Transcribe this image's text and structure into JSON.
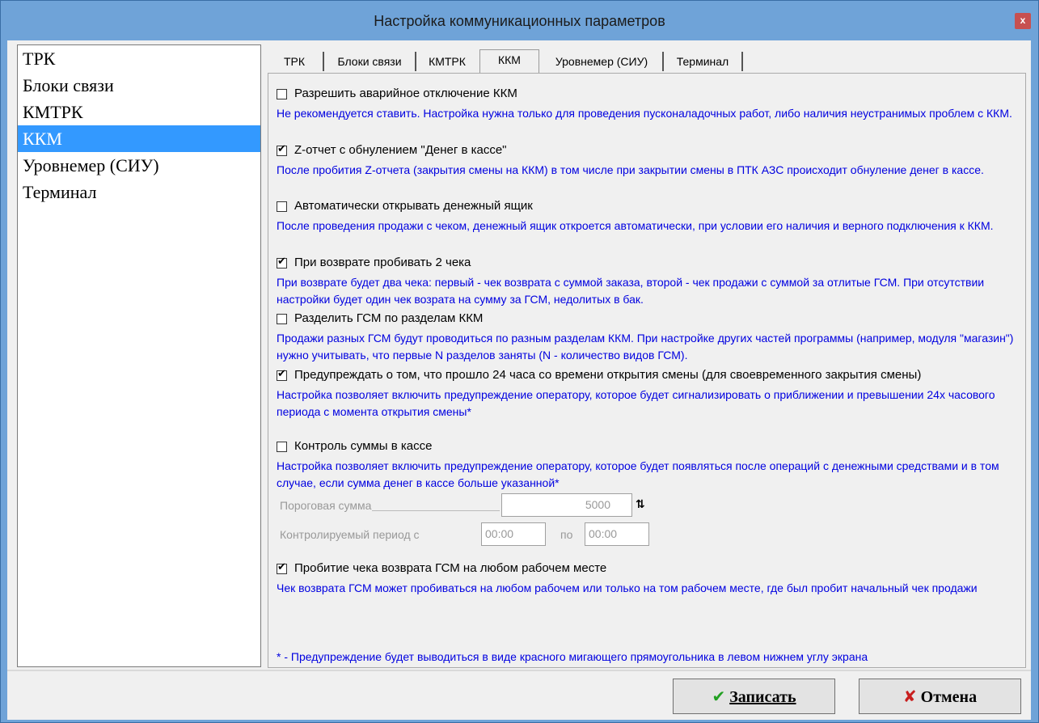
{
  "window": {
    "title": "Настройка коммуникационных параметров",
    "close_label": "x"
  },
  "sidebar": {
    "items": [
      {
        "label": "ТРК"
      },
      {
        "label": "Блоки связи"
      },
      {
        "label": "КМТРК"
      },
      {
        "label": "ККМ",
        "selected": true
      },
      {
        "label": "Уровнемер (СИУ)"
      },
      {
        "label": "Терминал"
      }
    ]
  },
  "tabs": [
    {
      "label": "ТРК"
    },
    {
      "label": "Блоки связи"
    },
    {
      "label": "КМТРК"
    },
    {
      "label": "ККМ",
      "selected": true
    },
    {
      "label": "Уровнемер (СИУ)"
    },
    {
      "label": "Терминал"
    }
  ],
  "options": [
    {
      "checked": false,
      "label": "Разрешить аварийное отключение ККМ",
      "desc": "Не рекомендуется ставить. Настройка нужна только для проведения пусконаладочных работ, либо наличия неустранимых проблем с ККМ."
    },
    {
      "checked": true,
      "label": "Z-отчет с обнулением \"Денег в кассе\"",
      "desc": "После пробития Z-отчета (закрытия смены на ККМ) в том числе при закрытии смены в ПТК АЗС происходит обнуление денег в кассе."
    },
    {
      "checked": false,
      "label": "Автоматически открывать денежный ящик",
      "desc": "После проведения продажи с чеком, денежный ящик откроется автоматически, при условии его наличия и верного подключения к ККМ."
    },
    {
      "checked": true,
      "label": "При возврате пробивать 2 чека",
      "desc": "При возврате будет два чека: первый - чек возврата с суммой заказа, второй - чек продажи с суммой за отлитые ГСМ. При отсутствии настройки будет один чек возрата на сумму за ГСМ, недолитых в бак."
    },
    {
      "checked": false,
      "label": "Разделить ГСМ по разделам ККМ",
      "desc": "Продажи разных ГСМ будут проводиться по разным разделам ККМ. При настройке других частей программы (например, модуля \"магазин\") нужно учитывать, что первые N разделов заняты (N - количество видов ГСМ)."
    },
    {
      "checked": true,
      "label": "Предупреждать о том, что прошло 24 часа со времени открытия смены (для своевременного закрытия смены)",
      "desc": "Настройка позволяет включить предупреждение оператору, которое будет сигнализировать о приближении и превышении 24х часового периода с момента открытия смены*"
    },
    {
      "checked": false,
      "label": "Контроль суммы в кассе",
      "desc": "Настройка позволяет включить предупреждение оператору, которое будет появляться после операций с денежными средствами и в том случае, если сумма денег в кассе больше указанной*"
    },
    {
      "checked": true,
      "label": "Пробитие чека возврата ГСМ на любом рабочем месте",
      "desc": "Чек возврата ГСМ может пробиваться на любом рабочем или только на том рабочем месте, где был пробит начальный чек продажи"
    }
  ],
  "threshold": {
    "label": "Пороговая сумма",
    "value": "5000"
  },
  "period": {
    "label": "Контролируемый период с",
    "from": "00:00",
    "to_label": "по",
    "to": "00:00"
  },
  "footnote": "* - Предупреждение будет выводиться в виде красного мигающего прямоугольника в левом нижнем углу экрана",
  "buttons": {
    "save": "Записать",
    "cancel": "Отмена"
  }
}
